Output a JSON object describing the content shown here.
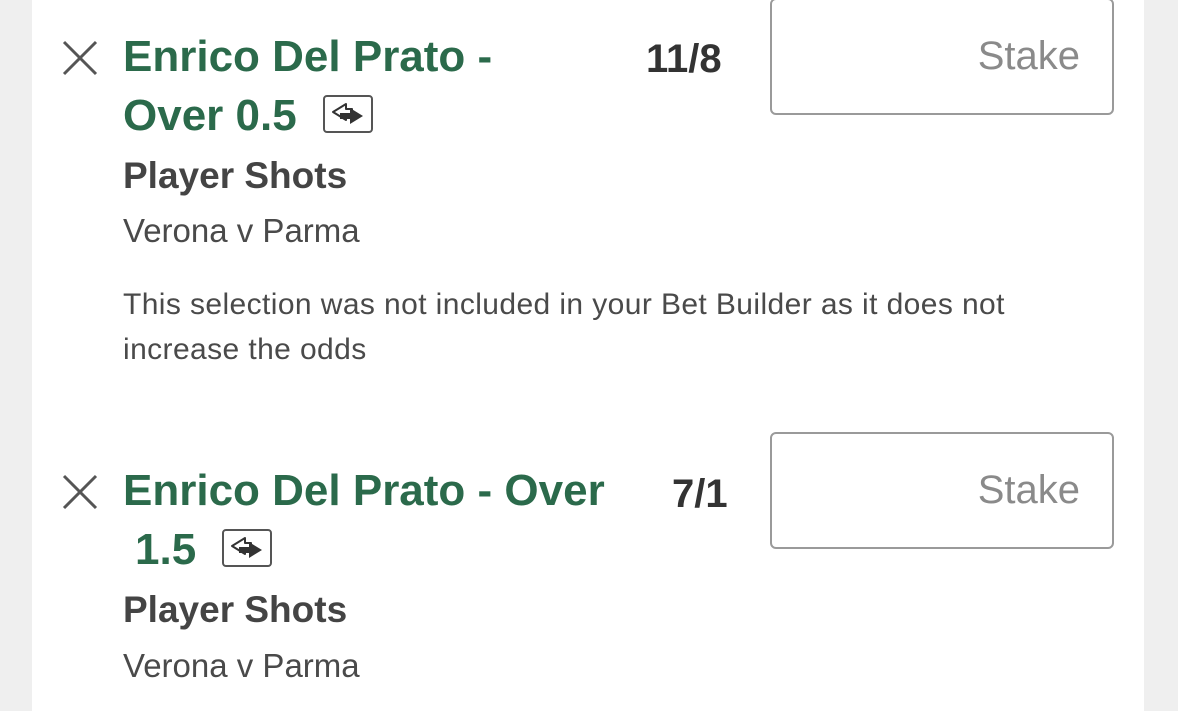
{
  "bets": [
    {
      "title_line1": "Enrico Del Prato -",
      "title_line2": "Over 0.5",
      "odds": "11/8",
      "stake_placeholder": "Stake",
      "market": "Player Shots",
      "event": "Verona v Parma",
      "note": "This selection was not included in your Bet Builder as it does not increase the odds"
    },
    {
      "title_line1": "Enrico Del Prato - Over",
      "title_line2": "1.5",
      "odds": "7/1",
      "stake_placeholder": "Stake",
      "market": "Player Shots",
      "event": "Verona v Parma"
    }
  ],
  "icons": {
    "remove": "close-icon",
    "swap": "swap-arrows-icon"
  },
  "colors": {
    "title": "#2b6a4b",
    "text": "#444444",
    "page_background": "#efefef",
    "panel_background": "#ffffff"
  }
}
